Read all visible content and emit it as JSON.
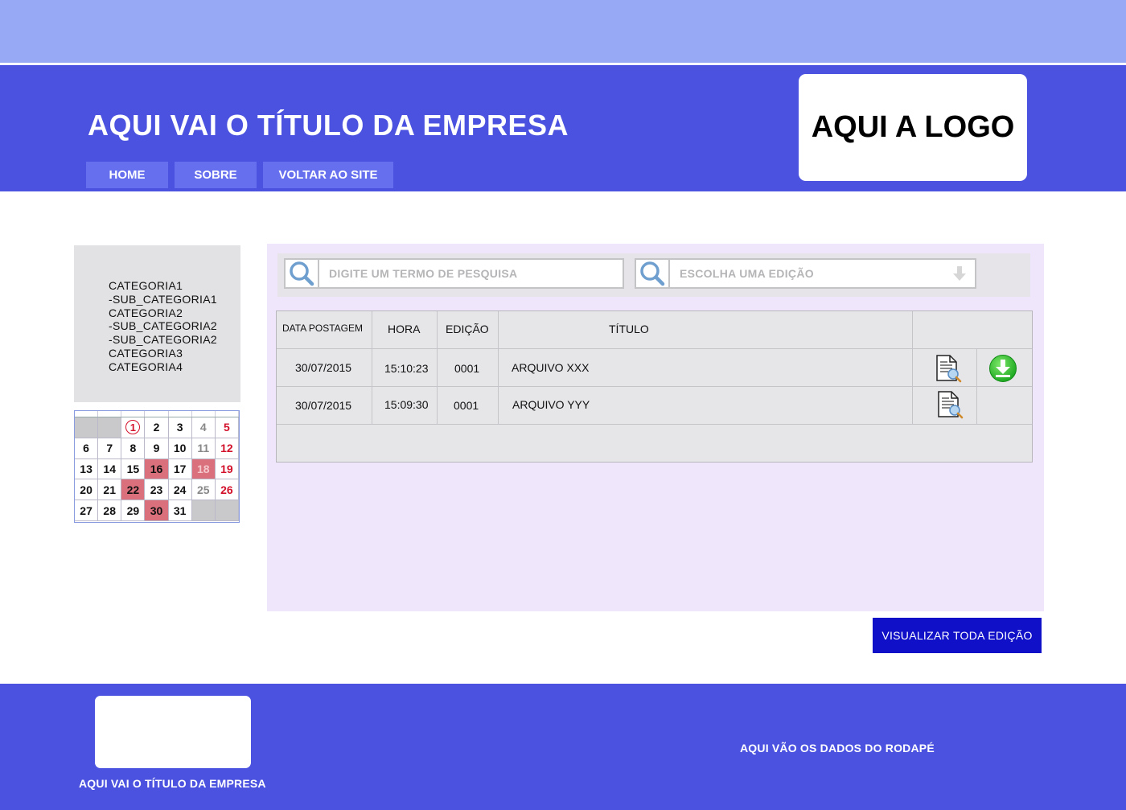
{
  "header": {
    "company_title": "AQUI VAI O TÍTULO DA EMPRESA",
    "logo_text": "AQUI A LOGO",
    "nav": [
      "HOME",
      "SOBRE",
      "VOLTAR AO SITE"
    ]
  },
  "sidebar": {
    "categories": [
      "CATEGORIA1",
      "-SUB_CATEGORIA1",
      "CATEGORIA2",
      "-SUB_CATEGORIA2",
      "-SUB_CATEGORIA2",
      "CATEGORIA3",
      "CATEGORIA4"
    ]
  },
  "calendar": {
    "weeks": [
      [
        "",
        "",
        "1",
        "2",
        "3",
        "4",
        "5"
      ],
      [
        "6",
        "7",
        "8",
        "9",
        "10",
        "11",
        "12"
      ],
      [
        "13",
        "14",
        "15",
        "16",
        "17",
        "18",
        "19"
      ],
      [
        "20",
        "21",
        "22",
        "23",
        "24",
        "25",
        "26"
      ],
      [
        "27",
        "28",
        "29",
        "30",
        "31",
        "",
        ""
      ]
    ],
    "circled_day": "1",
    "highlighted_days": [
      "16",
      "18",
      "22",
      "30"
    ]
  },
  "search": {
    "term_placeholder": "DIGITE UM TERMO DE PESQUISA",
    "edition_placeholder": "ESCOLHA UMA EDIÇÃO"
  },
  "table": {
    "headers": {
      "date": "DATA POSTAGEM",
      "time": "HORA",
      "edition": "EDIÇÃO",
      "title": "TÍTULO"
    },
    "rows": [
      {
        "date": "30/07/2015",
        "time": "15:10:23",
        "edition": "0001",
        "title": "ARQUIVO XXX",
        "icons": [
          "document-preview-icon",
          "download-icon"
        ]
      },
      {
        "date": "30/07/2015",
        "time": "15:09:30",
        "edition": "0001",
        "title": "ARQUIVO YYY",
        "icons": [
          "document-preview-icon"
        ]
      }
    ]
  },
  "view_all_button": "VISUALIZAR TODA EDIÇÃO",
  "footer": {
    "company_title": "AQUI VAI O TÍTULO DA EMPRESA",
    "data_text": "AQUI VÃO OS DADOS DO RODAPÉ"
  },
  "colors": {
    "top_strip": "#97a8f5",
    "header_bg": "#4b52e0",
    "nav_button": "#6670ef",
    "content_bg": "#efe6fb",
    "primary_button": "#1010c8",
    "calendar_highlight": "#d9707b",
    "weekend_red": "#d3102a"
  }
}
